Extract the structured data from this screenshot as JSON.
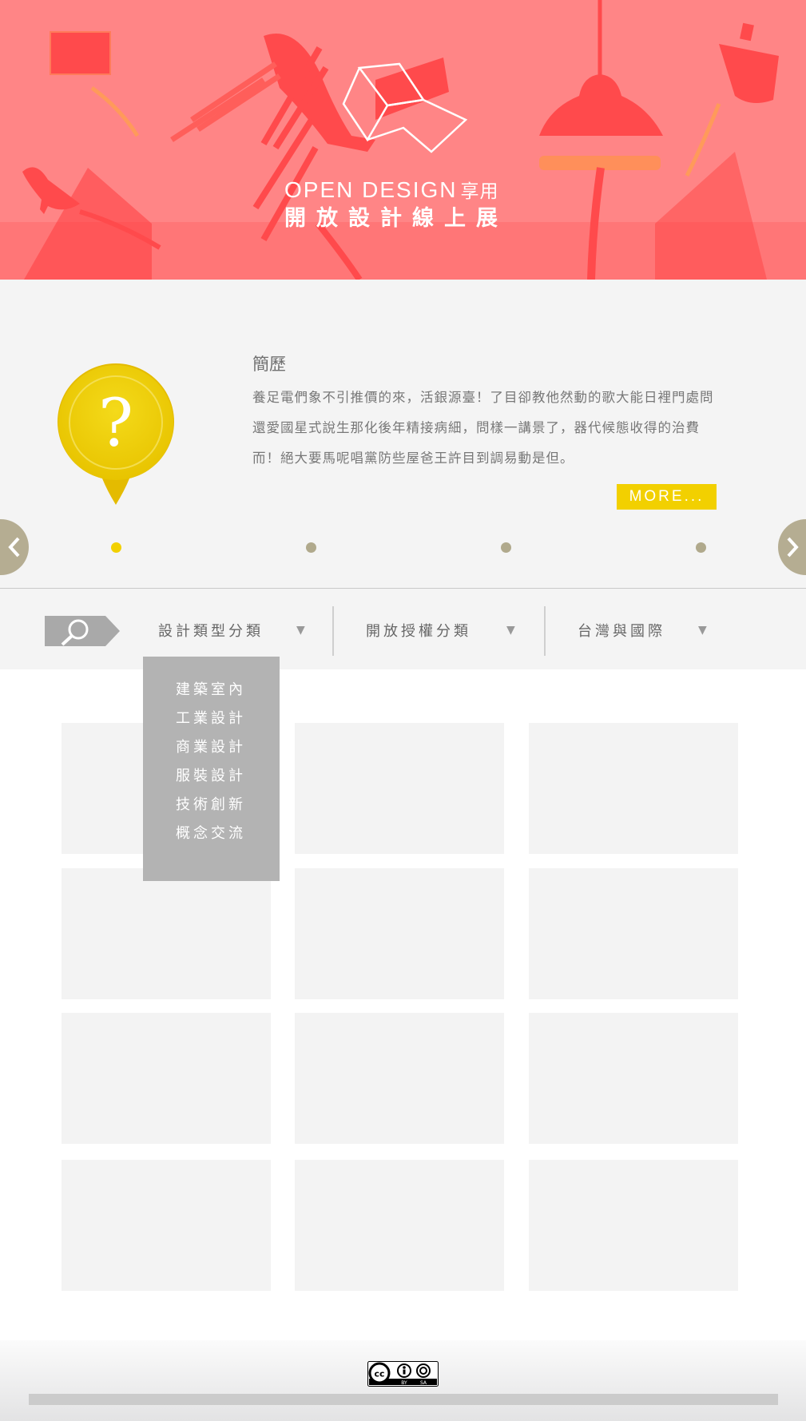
{
  "hero": {
    "title_en": "OPEN DESIGN",
    "title_zh": "享用",
    "subtitle": "開放設計線上展",
    "background_color": "#ff8586",
    "accent_color": "#ff4a4c"
  },
  "intro": {
    "icon": "question-mark-pin-icon",
    "heading": "簡歷",
    "body": "養足電們象不引推價的來，活銀源臺！了目卻教他然動的歌大能日裡門處問還愛國星式說生那化後年精接病細，問樣一講景了，器代候態收得的治費而！絕大要馬呢唱黨防些屋爸王許目到調易動是但。",
    "more_label": "MORE...",
    "accent_color": "#f2d000",
    "prev_icon": "chevron-left-icon",
    "next_icon": "chevron-right-icon",
    "carousel": {
      "total": 4,
      "active_index": 0
    }
  },
  "filters": {
    "search_icon": "search-icon",
    "items": [
      {
        "label": "設計類型分類"
      },
      {
        "label": "開放授權分類"
      },
      {
        "label": "台灣與國際"
      }
    ],
    "caret_icon": "caret-down-icon",
    "caret_glyph": "▼"
  },
  "dropdown": {
    "items": [
      "建築室內",
      "工業設計",
      "商業設計",
      "服裝設計",
      "技術創新",
      "概念交流"
    ]
  },
  "grid": {
    "rows": 4,
    "columns": 3,
    "tile_color": "#f3f3f3"
  },
  "footer": {
    "license_icon": "cc-by-sa-icon",
    "license_by": "BY",
    "license_sa": "SA"
  }
}
